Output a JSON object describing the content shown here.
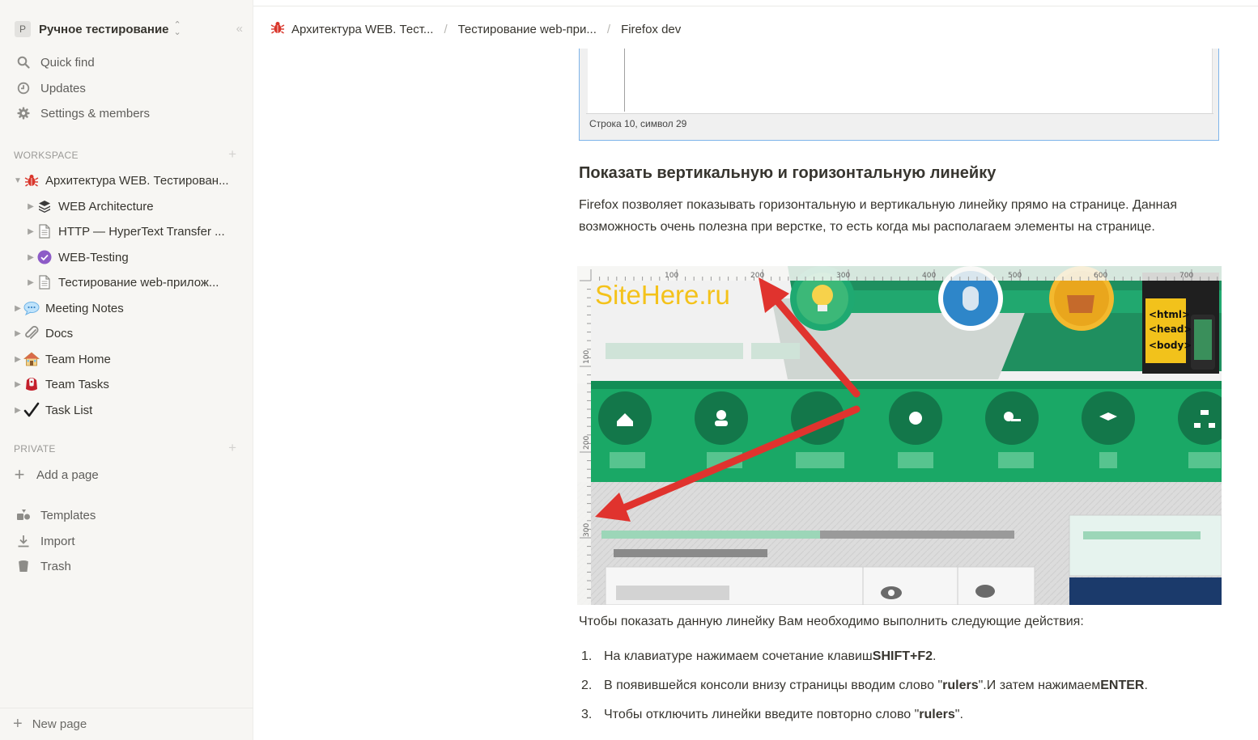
{
  "workspace": {
    "avatar": "P",
    "name": "Ручное тестирование"
  },
  "sidebar": {
    "top": [
      {
        "label": "Quick find",
        "icon": "search-icon"
      },
      {
        "label": "Updates",
        "icon": "clock-icon"
      },
      {
        "label": "Settings & members",
        "icon": "gear-icon"
      }
    ],
    "workspace_heading": "WORKSPACE",
    "tree": [
      {
        "label": "Архитектура WEB. Тестирован...",
        "icon": "bug-icon",
        "level": 0,
        "expanded": true
      },
      {
        "label": "WEB Architecture",
        "icon": "layers-icon",
        "level": 1
      },
      {
        "label": "HTTP — HyperText Transfer ...",
        "icon": "page-icon",
        "level": 1
      },
      {
        "label": "WEB-Testing",
        "icon": "check-circle-icon",
        "level": 1
      },
      {
        "label": "Тестирование web-прилож...",
        "icon": "page-icon",
        "level": 1
      },
      {
        "label": "Meeting Notes",
        "icon": "speech-bubble-icon",
        "level": 0
      },
      {
        "label": "Docs",
        "icon": "paperclip-icon",
        "level": 0
      },
      {
        "label": "Team Home",
        "icon": "house-icon",
        "level": 0
      },
      {
        "label": "Team Tasks",
        "icon": "gift-icon",
        "level": 0
      },
      {
        "label": "Task List",
        "icon": "checkmark-icon",
        "level": 0
      }
    ],
    "private_heading": "PRIVATE",
    "add_page": "Add a page",
    "bottom": [
      {
        "label": "Templates",
        "icon": "templates-icon"
      },
      {
        "label": "Import",
        "icon": "import-icon"
      },
      {
        "label": "Trash",
        "icon": "trash-icon"
      }
    ],
    "new_page": "New page"
  },
  "breadcrumbs": [
    {
      "label": "Архитектура WEB. Тест...",
      "icon": "bug-icon"
    },
    {
      "label": "Тестирование web-при..."
    },
    {
      "label": "Firefox dev"
    }
  ],
  "editor_snapshot": {
    "status": "Строка 10, символ 29"
  },
  "section": {
    "heading": "Показать вертикальную и горизонтальную линейку",
    "paragraph": "Firefox позволяет показывать горизонтальную и вертикальную линейку прямо на странице. Данная возможность очень полезна при верстке, то есть когда мы располагаем элементы на странице."
  },
  "figure": {
    "logo": "SiteHere.ru",
    "ruler_h": [
      "100",
      "200",
      "300",
      "400",
      "500",
      "600",
      "700"
    ],
    "ruler_v": [
      "100",
      "200",
      "300"
    ],
    "code_tags": [
      "<html>",
      "<head>",
      "<body>"
    ]
  },
  "instructions": {
    "intro": "Чтобы показать данную линейку Вам необходимо выполнить следующие действия:",
    "steps": [
      {
        "num": "1.",
        "pre": "На клавиатуре нажимаем сочетание клавиш ",
        "bold": "SHIFT+F2",
        "post": "."
      },
      {
        "num": "2.",
        "pre": "В появившейся консоли внизу страницы вводим слово \"",
        "bold": "rulers",
        "post": "\".И затем нажимаем ",
        "bold2": "ENTER",
        "post2": "."
      },
      {
        "num": "3.",
        "pre": "Чтобы отключить линейки введите повторно слово \"",
        "bold": "rulers",
        "post": "\"."
      }
    ]
  },
  "colors": {
    "sidebar_bg": "#f7f6f3",
    "green": "#1fa971",
    "arrow": "#e0332e"
  }
}
